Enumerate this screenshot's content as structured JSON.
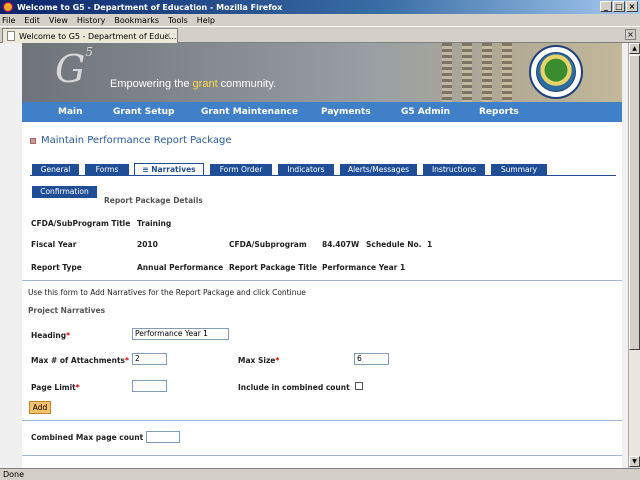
{
  "window": {
    "title": "Welcome to G5 - Department of Education - Mozilla Firefox",
    "min": "_",
    "max": "□",
    "close": "×"
  },
  "menu": [
    "File",
    "Edit",
    "View",
    "History",
    "Bookmarks",
    "Tools",
    "Help"
  ],
  "browser_tab": {
    "title": "Welcome to G5 - Department of Educ...",
    "close": "×"
  },
  "banner": {
    "logo_text": "G",
    "logo_sup": "5",
    "tagline_pre": "Empowering the ",
    "tagline_highlight": "grant",
    "tagline_post": " community."
  },
  "nav": [
    "Main",
    "Grant Setup",
    "Grant Maintenance",
    "Payments",
    "G5 Admin",
    "Reports"
  ],
  "page_title": "Maintain Performance Report Package",
  "tabs": [
    "General",
    "Forms",
    "Narratives",
    "Form Order",
    "Indicators",
    "Alerts/Messages",
    "Instructions",
    "Summary",
    "Confirmation"
  ],
  "active_tab_prefix": "≡",
  "details_heading": "Report Package Details",
  "details": {
    "cfda_title_label": "CFDA/SubProgram Title",
    "cfda_title_value": "Training",
    "fiscal_year_label": "Fiscal Year",
    "fiscal_year_value": "2010",
    "cfda_sub_label": "CFDA/Subprogram",
    "cfda_sub_value": "84.407W",
    "schedule_label": "Schedule No.",
    "schedule_value": "1",
    "report_type_label": "Report Type",
    "report_type_value": "Annual Performance",
    "package_title_label": "Report Package Title",
    "package_title_value": "Performance Year 1"
  },
  "instruction": "Use this form to Add Narratives for the Report Package and click Continue",
  "narratives_heading": "Project Narratives",
  "form": {
    "heading_label": "Heading",
    "heading_value": "Performance Year 1",
    "max_attach_label": "Max # of Attachments",
    "max_attach_value": "2",
    "max_size_label": "Max Size",
    "max_size_value": "6",
    "page_limit_label": "Page Limit",
    "page_limit_value": "",
    "include_label": "Include in combined count",
    "add_label": "Add",
    "combined_label": "Combined Max page count",
    "combined_value": "",
    "req_mark": "*"
  },
  "status": "Done"
}
